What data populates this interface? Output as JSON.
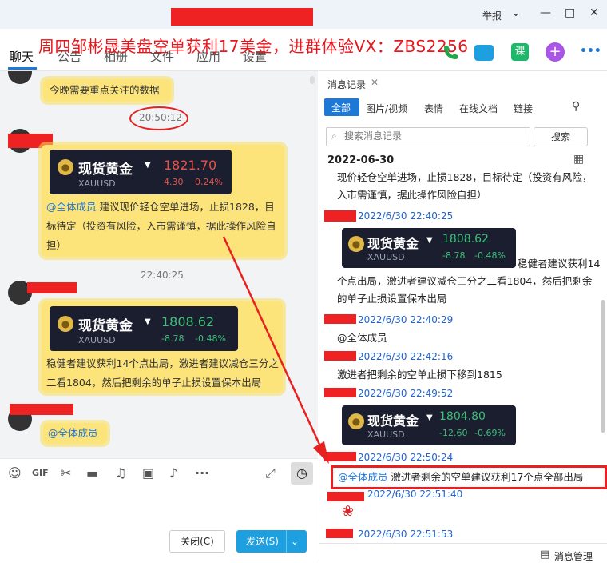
{
  "window": {
    "report_label": "举报",
    "minimize_icon": "—",
    "restore_icon": "□",
    "close_icon": "✕",
    "dropdown_icon": "⌄"
  },
  "banner": "周四邹彬晟美盘空单获利17美金，进群体验VX：ZBS2256",
  "nav": {
    "tabs": [
      "聊天",
      "公告",
      "相册",
      "文件",
      "应用",
      "设置"
    ]
  },
  "icons": {
    "phone": "📞",
    "video": "📹",
    "plus": "+",
    "more": "•••"
  },
  "chat": {
    "msg1": "今晚需要重点关注的数据",
    "time1": "20:50:12",
    "quote1": {
      "name": "现货黄金",
      "code": "XAUUSD",
      "price": "1821.70",
      "change": "4.30",
      "pct": "0.24%"
    },
    "msg2_mention": "@全体成员",
    "msg2_text": " 建议现价轻仓空单进场，止损1828，目标待定（投资有风险，入市需谨慎，据此操作风险自担）",
    "time2": "22:40:25",
    "quote2": {
      "name": "现货黄金",
      "code": "XAUUSD",
      "price": "1808.62",
      "change": "-8.78",
      "pct": "-0.48%"
    },
    "msg3": "稳健者建议获利14个点出局，激进者建议减仓三分之二看1804，然后把剩余的单子止损设置保本出局",
    "msg4_mention": "@全体成员"
  },
  "toolbar": {
    "close_label": "关闭(C)",
    "send_label": "发送(S)"
  },
  "history": {
    "tab_title": "消息记录",
    "filters": [
      "全部",
      "图片/视频",
      "表情",
      "在线文档",
      "链接"
    ],
    "search_placeholder": "搜索消息记录",
    "search_button": "搜索",
    "date_header": "2022-06-30",
    "entries": {
      "e1_text": "现价轻仓空单进场，止损1828，目标待定（投资有风险，入市需谨慎，据此操作风险自担）",
      "e2_time": "2022/6/30 22:40:25",
      "e2_quote": {
        "name": "现货黄金",
        "code": "XAUUSD",
        "price": "1808.62",
        "change": "-8.78",
        "pct": "-0.48%"
      },
      "e2_text": "稳健者建议获利14个点出局，激进者建议减仓三分之二看1804，然后把剩余的单子止损设置保本出局",
      "e3_time": "2022/6/30 22:40:29",
      "e3_mention": "@全体成员",
      "e4_time": "2022/6/30 22:42:16",
      "e4_text": "激进者把剩余的空单止损下移到1815",
      "e5_time": "2022/6/30 22:49:52",
      "e5_quote": {
        "name": "现货黄金",
        "code": "XAUUSD",
        "price": "1804.80",
        "change": "-12.60",
        "pct": "-0.69%"
      },
      "e6_time": "2022/6/30 22:50:24",
      "e6_mention": "@全体成员",
      "e6_text": " 激进者剩余的空单建议获利17个点全部出局",
      "e7_time": "2022/6/30 22:51:40",
      "e8_time": "2022/6/30 22:51:53"
    },
    "manage_label": "消息管理"
  }
}
